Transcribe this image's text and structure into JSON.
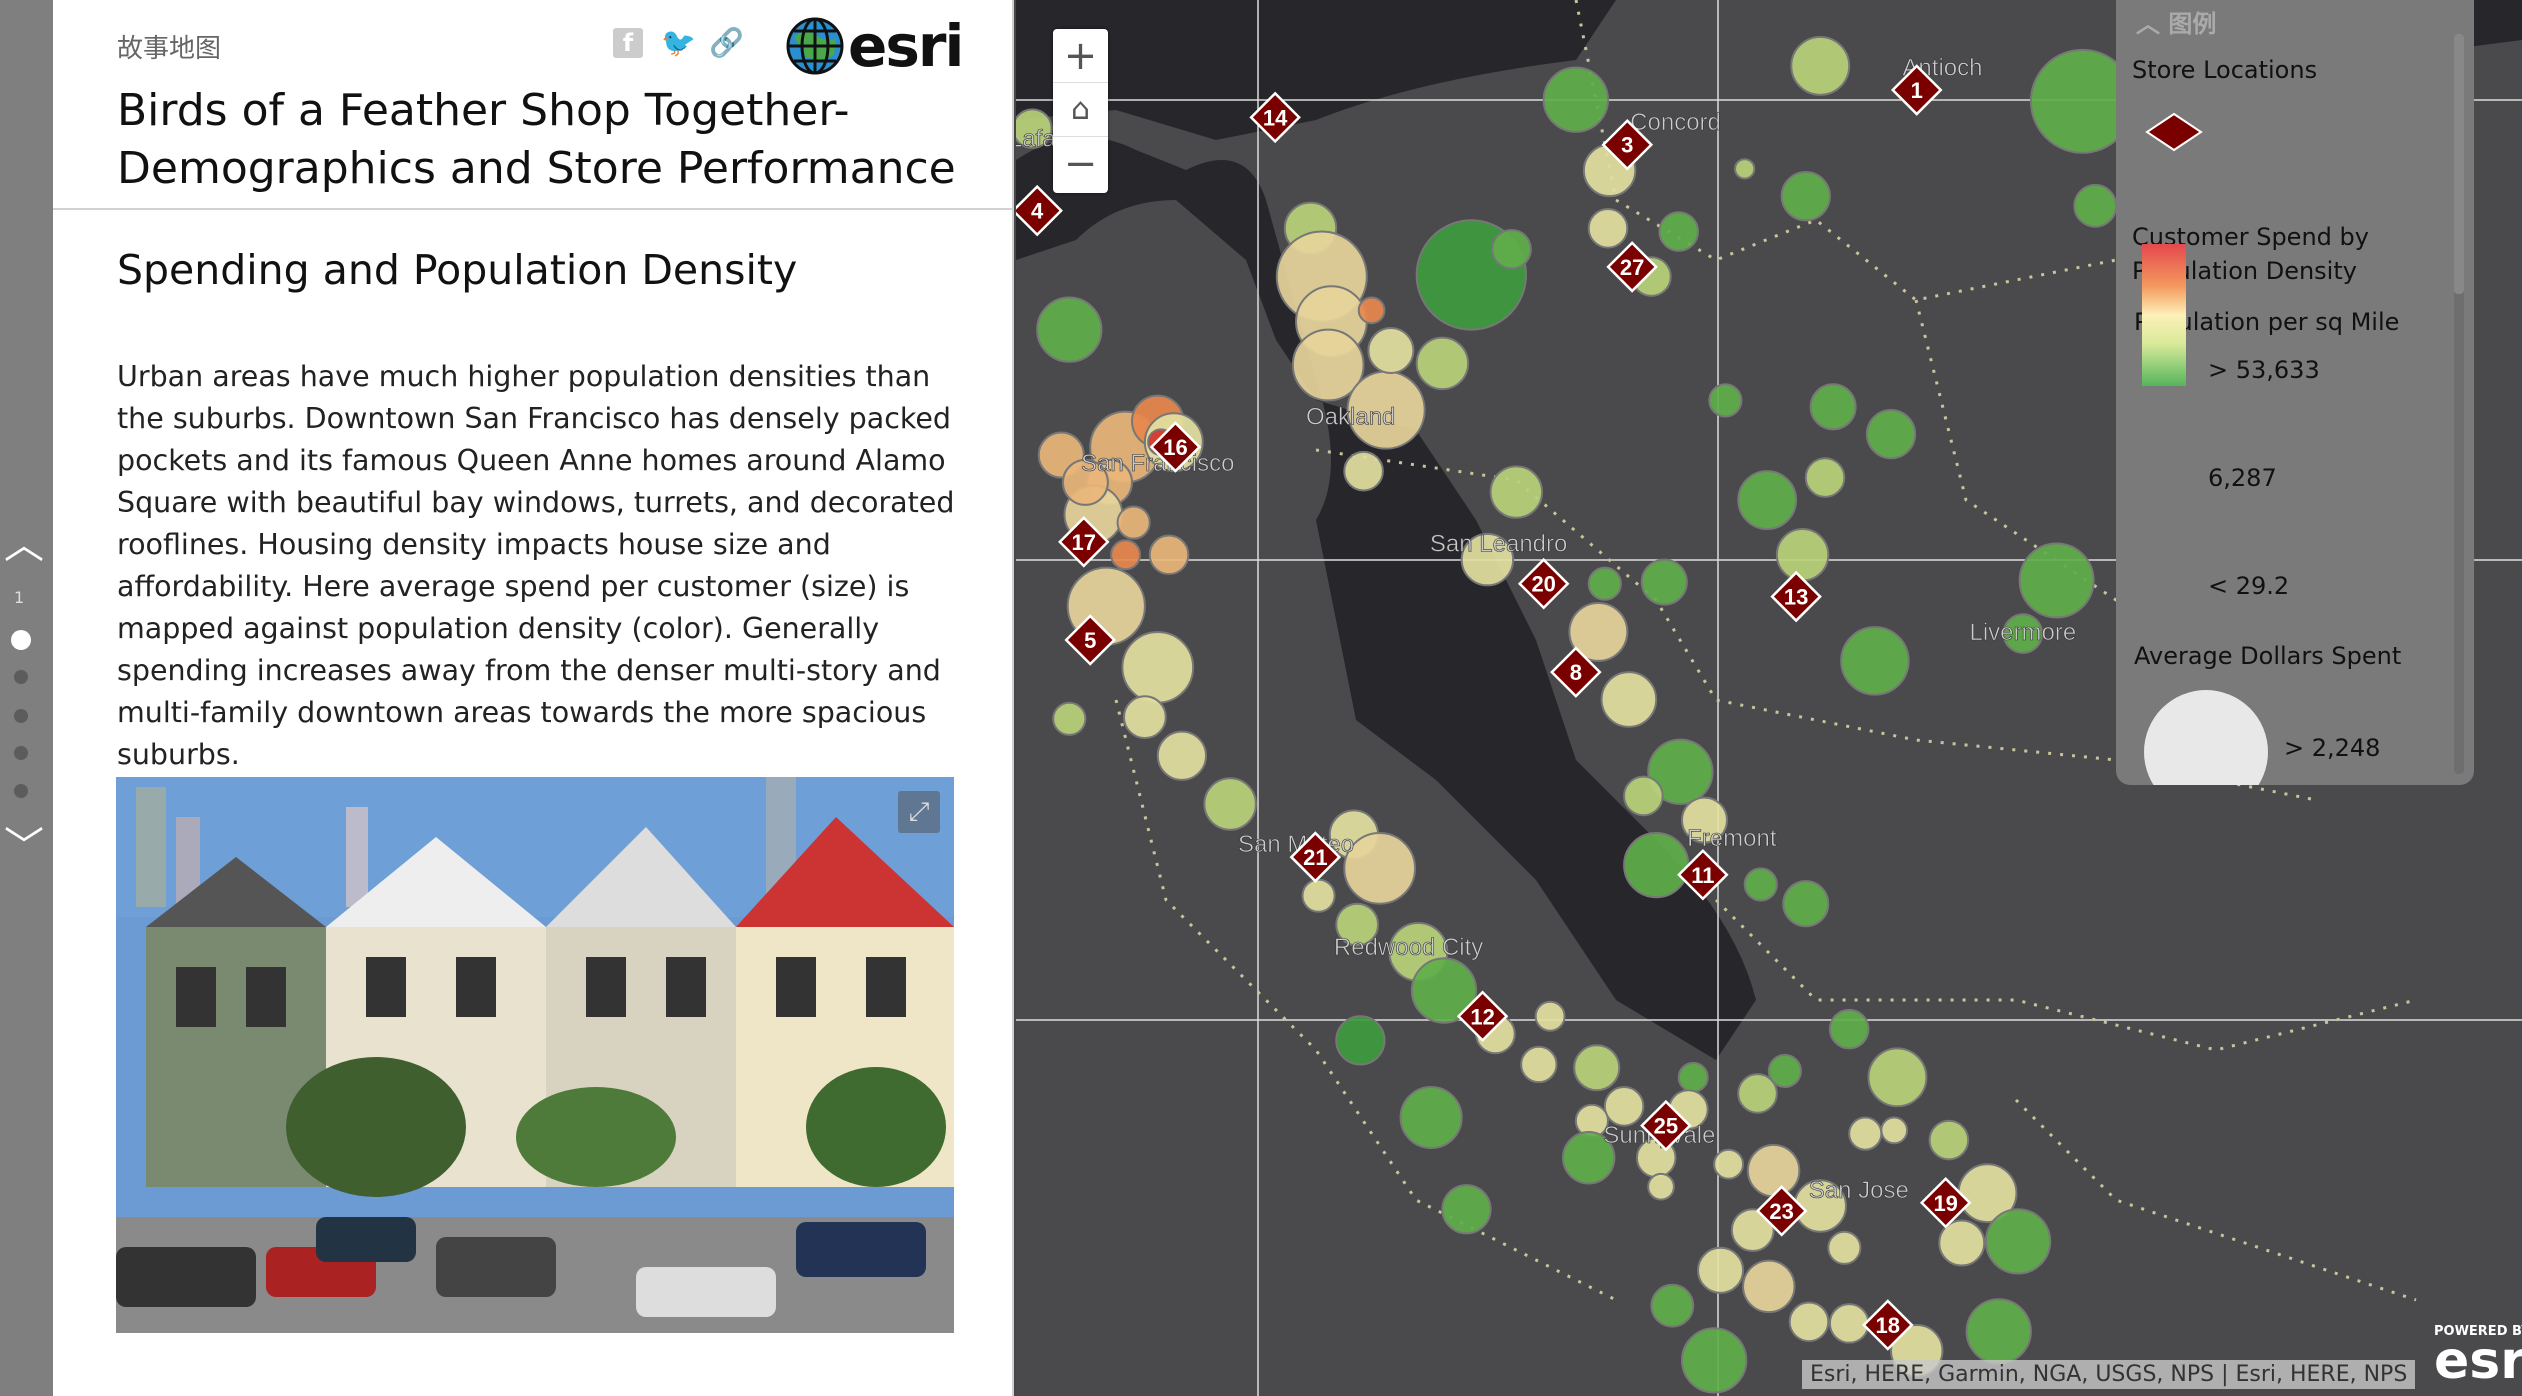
{
  "nav": {
    "current_page": "1",
    "pages": 5,
    "active_index": 0
  },
  "header": {
    "brand": "故事地图",
    "logo_text": "esri",
    "social": [
      "facebook-icon",
      "twitter-icon",
      "link-icon"
    ]
  },
  "title": "Birds of a Feather Shop Together-Demographics and Store Performance",
  "section": {
    "heading": "Spending and Population Density",
    "body": "Urban areas have much higher population densities than the suburbs. Downtown San Francisco has densely packed pockets and its famous Queen Anne homes around Alamo Square with beautiful bay windows, turrets, and decorated rooflines. Housing density impacts house size and affordability. Here average spend per customer (size) is mapped against population density (color). Generally spending increases away from the denser multi-story and multi-family downtown areas towards the more spacious suburbs."
  },
  "map": {
    "places": [
      "Antioch",
      "Concord",
      "Oakland",
      "San Francisco",
      "San Leandro",
      "Livermore",
      "Fremont",
      "San Mateo",
      "Redwood City",
      "Sunnyvale",
      "San Jose",
      "Lafa"
    ],
    "stores": [
      "1",
      "3",
      "4",
      "5",
      "8",
      "11",
      "12",
      "13",
      "14",
      "16",
      "17",
      "18",
      "19",
      "20",
      "21",
      "23",
      "25",
      "27"
    ],
    "store_color": "#7a0000",
    "attribution": "Esri, HERE, Garmin, NGA, USGS, NPS | Esri, HERE, NPS",
    "powered_by": "POWERED BY",
    "powered_logo": "esri"
  },
  "legend": {
    "header": "图例",
    "store_title": "Store Locations",
    "layer_title": "Customer Spend by Population Density",
    "color_title": "Population per sq Mile",
    "color_high": "> 53,633",
    "color_mid": "6,287",
    "color_low": "< 29.2",
    "size_title": "Average Dollars Spent",
    "size_high": "> 2,248",
    "color_ramp": [
      "#e5484d",
      "#f49a5e",
      "#fdf0b8",
      "#d9ea9a",
      "#56b55c"
    ]
  }
}
